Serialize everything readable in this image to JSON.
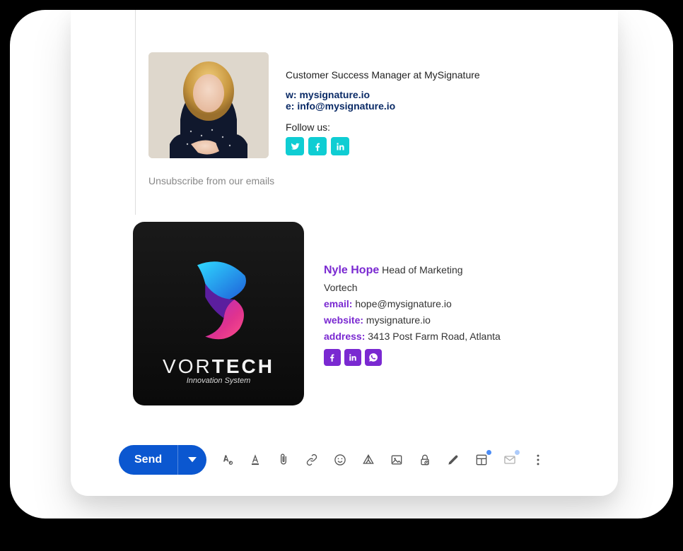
{
  "signature1": {
    "title": "Customer Success Manager at MySignature",
    "web_label": "w:",
    "web_value": "mysignature.io",
    "email_label": "e:",
    "email_value": "info@mysignature.io",
    "follow": "Follow us:",
    "socials": [
      "twitter",
      "facebook",
      "linkedin"
    ],
    "unsubscribe": "Unsubscribe from our emails"
  },
  "signature2": {
    "logo_text_1": "VOR",
    "logo_text_2": "TECH",
    "logo_sub": "Innovation System",
    "name": "Nyle Hope",
    "role": "Head of Marketing",
    "company": "Vortech",
    "email_label": "email:",
    "email_value": "hope@mysignature.io",
    "website_label": "website:",
    "website_value": "mysignature.io",
    "address_label": "address:",
    "address_value": "3413 Post Farm Road, Atlanta",
    "socials": [
      "facebook",
      "linkedin",
      "whatsapp"
    ]
  },
  "toolbar": {
    "send": "Send",
    "icons": [
      "text-style",
      "text-color",
      "attach",
      "link",
      "emoji",
      "drive",
      "image",
      "lock",
      "draw",
      "layout",
      "mail",
      "more"
    ]
  },
  "colors": {
    "brand_blue": "#0b57d0",
    "sig1_social": "#0fcdd3",
    "sig1_link": "#0a2a66",
    "sig2_accent": "#7a29d1"
  }
}
